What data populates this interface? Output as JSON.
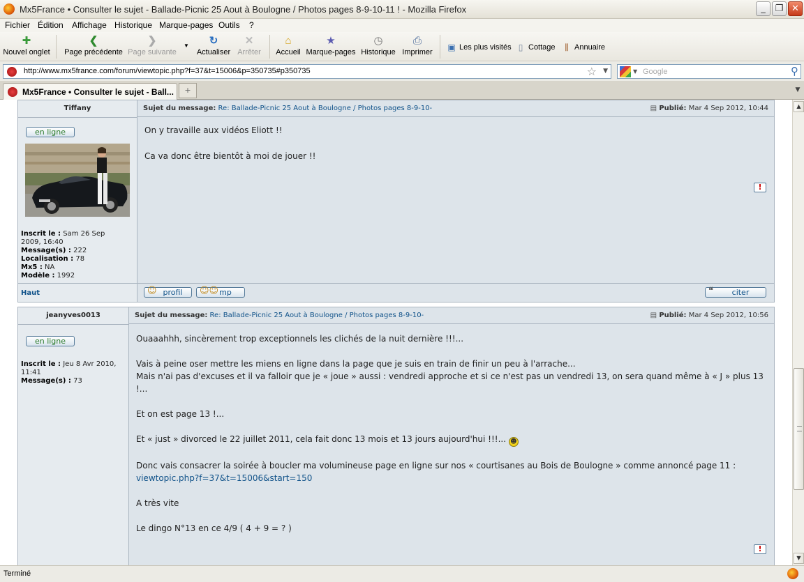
{
  "window": {
    "title": "Mx5France • Consulter le sujet - Ballade-Picnic 25 Aout à Boulogne / Photos pages 8-9-10-11 ! - Mozilla Firefox",
    "minimize": "_",
    "maximize": "❐",
    "close": "✕"
  },
  "menu": [
    "Fichier",
    "Édition",
    "Affichage",
    "Historique",
    "Marque-pages",
    "Outils",
    "?"
  ],
  "toolbar": {
    "new_tab": "Nouvel onglet",
    "back": "Page précédente",
    "forward": "Page suivante",
    "reload": "Actualiser",
    "stop": "Arrêter",
    "home": "Accueil",
    "bookmarks": "Marque-pages",
    "history": "Historique",
    "print": "Imprimer",
    "bm1": "Les plus visités",
    "bm2": "Cottage",
    "bm3": "Annuaire"
  },
  "nav": {
    "url": "http://www.mx5france.com/forum/viewtopic.php?f=37&t=15006&p=350735#p350735",
    "search_placeholder": "Google"
  },
  "tab": {
    "label": "Mx5France • Consulter le sujet - Ball...",
    "new_tab_symbol": "+"
  },
  "posts": [
    {
      "author": "Tiffany",
      "subject_label": "Sujet du message:",
      "subject": "Re: Ballade-Picnic 25 Aout à Boulogne / Photos pages 8-9-10-",
      "published_label": "Publié:",
      "published": "Mar 4 Sep 2012, 10:44",
      "online": "en ligne",
      "info": {
        "inscrit_label": "Inscrit le :",
        "inscrit_a": "Sam 26 Sep",
        "inscrit_b": "2009, 16:40",
        "messages_label": "Message(s) :",
        "messages": "222",
        "localisation_label": "Localisation :",
        "localisation": "78",
        "mx5_label": "Mx5 :",
        "mx5": "NA",
        "modele_label": "Modèle :",
        "modele": "1992"
      },
      "lines": [
        "On y travaille aux vidéos Eliott !!",
        "Ca va donc être bientôt à moi de jouer !!"
      ],
      "haut": "Haut",
      "profil": "profil",
      "mp": "mp",
      "citer": "citer",
      "report": "!"
    },
    {
      "author": "jeanyves0013",
      "subject_label": "Sujet du message:",
      "subject": "Re: Ballade-Picnic 25 Aout à Boulogne / Photos pages 8-9-10-",
      "published_label": "Publié:",
      "published": "Mar 4 Sep 2012, 10:56",
      "online": "en ligne",
      "info": {
        "inscrit_label": "Inscrit le :",
        "inscrit_a": "Jeu 8 Avr 2010,",
        "inscrit_b": "11:41",
        "messages_label": "Message(s) :",
        "messages": "73"
      },
      "lines": [
        "Ouaaahhh, sincèrement trop exceptionnels les clichés de la nuit dernière !!!...",
        "Vais à peine oser mettre les miens en ligne dans la page que je suis en train de finir un peu à l'arrache...",
        "Mais n'ai pas d'excuses et il va falloir que je « joue » aussi : vendredi approche et si ce n'est pas un vendredi 13, on sera quand même à « J » plus 13 !...",
        "Et on est page 13 !...",
        "Et « just » divorced le 22 juillet 2011, cela fait donc 13 mois et 13 jours aujourd'hui  !!!...",
        "Donc vais consacrer la soirée à boucler ma volumineuse page en ligne sur nos « courtisanes au Bois de Boulogne » comme annoncé page 11 :",
        "viewtopic.php?f=37&t=15006&start=150",
        "A très vite",
        "Le dingo N°13 en ce 4/9 ( 4 + 9 = ? )"
      ],
      "report": "!"
    }
  ],
  "status": "Terminé",
  "colors": {
    "link": "#105289",
    "post_bg": "#dde4ea",
    "online_green": "#2a7a2a"
  }
}
